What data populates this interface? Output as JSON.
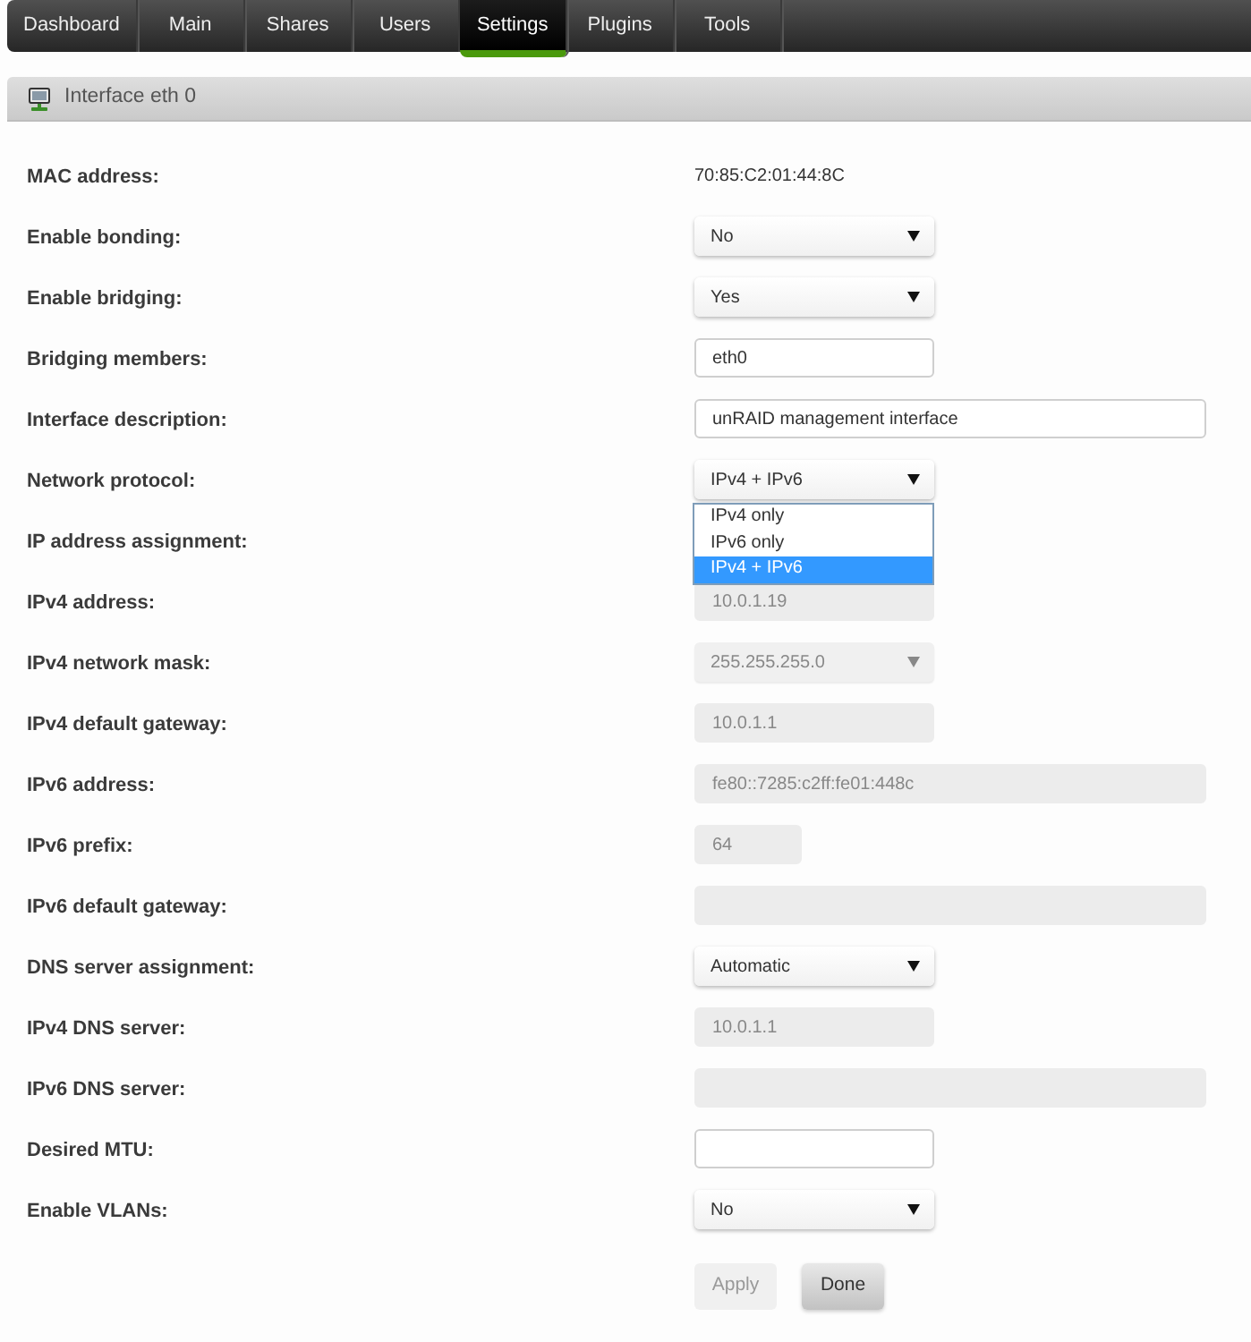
{
  "tabs": [
    {
      "label": "Dashboard",
      "selected": false
    },
    {
      "label": "Main",
      "selected": false
    },
    {
      "label": "Shares",
      "selected": false
    },
    {
      "label": "Users",
      "selected": false
    },
    {
      "label": "Settings",
      "selected": true
    },
    {
      "label": "Plugins",
      "selected": false
    },
    {
      "label": "Tools",
      "selected": false
    }
  ],
  "section": {
    "title": "Interface eth 0"
  },
  "rows": [
    {
      "label": "MAC address:",
      "kind": "text",
      "value": "70:85:C2:01:44:8C"
    },
    {
      "label": "Enable bonding:",
      "kind": "select",
      "value": "No",
      "disabled": false
    },
    {
      "label": "Enable bridging:",
      "kind": "select",
      "value": "Yes",
      "disabled": false
    },
    {
      "label": "Bridging members:",
      "kind": "input",
      "value": "eth0",
      "disabled": false
    },
    {
      "label": "Interface description:",
      "kind": "wideinput",
      "value": "unRAID management interface",
      "disabled": false
    },
    {
      "label": "Network protocol:",
      "kind": "select",
      "value": "IPv4 + IPv6",
      "disabled": false,
      "expanded": true,
      "options": [
        {
          "label": "IPv4 only",
          "selected": false
        },
        {
          "label": "IPv6 only",
          "selected": false
        },
        {
          "label": "IPv4 + IPv6",
          "selected": true
        }
      ]
    },
    {
      "label": "IP address assignment:",
      "kind": "covered"
    },
    {
      "label": "IPv4 address:",
      "kind": "input",
      "value": "10.0.1.19",
      "disabled": true
    },
    {
      "label": "IPv4 network mask:",
      "kind": "select",
      "value": "255.255.255.0",
      "disabled": true
    },
    {
      "label": "IPv4 default gateway:",
      "kind": "input",
      "value": "10.0.1.1",
      "disabled": true
    },
    {
      "label": "IPv6 address:",
      "kind": "wideinput",
      "value": "fe80::7285:c2ff:fe01:448c",
      "disabled": true
    },
    {
      "label": "IPv6 prefix:",
      "kind": "tinyinput",
      "value": "64",
      "disabled": true
    },
    {
      "label": "IPv6 default gateway:",
      "kind": "wideinput",
      "disabled": true
    },
    {
      "label": "DNS server assignment:",
      "kind": "select",
      "value": "Automatic",
      "disabled": false
    },
    {
      "label": "IPv4 DNS server:",
      "kind": "input",
      "value": "10.0.1.1",
      "disabled": true
    },
    {
      "label": "IPv6 DNS server:",
      "kind": "wideinput",
      "disabled": true
    },
    {
      "label": "Desired MTU:",
      "kind": "input",
      "disabled": false
    },
    {
      "label": "Enable VLANs:",
      "kind": "select",
      "value": "No",
      "disabled": false
    }
  ],
  "buttons": [
    {
      "label": "Apply",
      "disabled": true
    },
    {
      "label": "Done",
      "disabled": false
    }
  ]
}
